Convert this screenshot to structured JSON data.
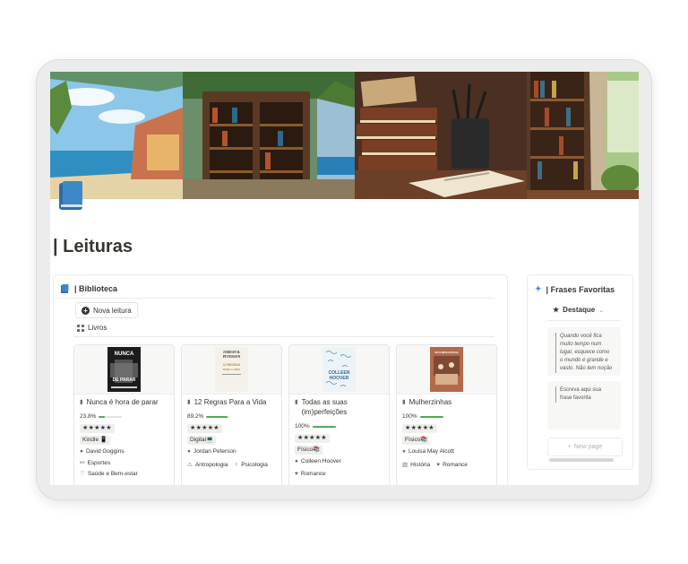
{
  "page": {
    "title": "| Leituras"
  },
  "library": {
    "header": "| Biblioteca",
    "new_button": "Nova leitura",
    "view_tab": "Livros",
    "cards": [
      {
        "title": "Nunca é hora de parar",
        "cover_title": [
          "NUNCA",
          "DE PARAR"
        ],
        "progress_text": "23.8%",
        "progress": 0.238,
        "stars": "★★★★★",
        "format": "Kindle 📱",
        "author": "David Goggins",
        "categories": [
          "Esportes",
          "Saúde e Bem-estar"
        ]
      },
      {
        "title": "12 Regras Para a Vida",
        "cover_title": [
          "JORDAN B.",
          "PETERSON",
          "12 REGRAS",
          "PARA A VIDA"
        ],
        "progress_text": "89.2%",
        "progress": 0.892,
        "stars": "★★★★★",
        "format": "Digital💻",
        "author": "Jordan Peterson",
        "categories": [
          "Antropologia",
          "Psicologia"
        ]
      },
      {
        "title": "Todas as suas (im)perfeições",
        "cover_title": [
          "COLLEEN",
          "HOOVER"
        ],
        "progress_text": "100%",
        "progress": 1.0,
        "stars": "★★★★★",
        "format": "Físico📚",
        "author": "Colleen Hoover",
        "categories": [
          "Romance"
        ]
      },
      {
        "title": "Mulherzinhas",
        "cover_title": [
          "MULHERZINHAS"
        ],
        "progress_text": "100%",
        "progress": 1.0,
        "stars": "★★★★★",
        "format": "Físico📚",
        "author": "Louisa May Alcott",
        "categories": [
          "História",
          "Romance"
        ]
      }
    ]
  },
  "quotes": {
    "header": "| Frases Favoritas",
    "tab": "Destaque",
    "items": [
      "Quando você fica muito tempo num lugar, esquece como o mundo é grande e vasto. Não tem noção",
      "Escreva aqui sua frase favorita"
    ],
    "new_page": "New page"
  },
  "colors": {
    "progress": "#57a65a",
    "accent_icon": "#2e6da4",
    "sparkle": "#4a8fd6"
  }
}
